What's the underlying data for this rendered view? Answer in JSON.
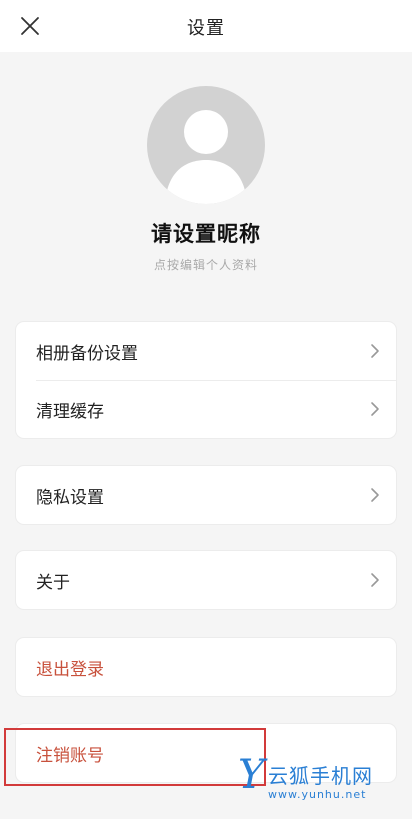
{
  "topbar": {
    "title": "设置",
    "close_icon": "close-icon"
  },
  "profile": {
    "avatar_icon": "user-avatar-icon",
    "nickname": "请设置昵称",
    "hint": "点按编辑个人资料"
  },
  "groups": [
    {
      "items": [
        {
          "label": "相册备份设置"
        },
        {
          "label": "清理缓存"
        }
      ]
    },
    {
      "items": [
        {
          "label": "隐私设置"
        }
      ]
    },
    {
      "items": [
        {
          "label": "关于"
        }
      ]
    },
    {
      "items": [
        {
          "label": "退出登录"
        }
      ]
    },
    {
      "items": [
        {
          "label": "注销账号"
        }
      ]
    }
  ],
  "watermark": {
    "name": "云狐手机网",
    "url": "www.yunhu.net"
  },
  "colors": {
    "danger": "#c8513c",
    "highlight": "#d23a3a",
    "watermark": "#2a7fd4"
  }
}
